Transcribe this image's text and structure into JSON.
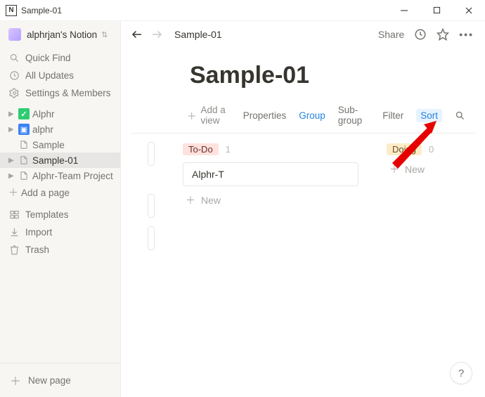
{
  "window": {
    "title": "Sample-01"
  },
  "workspace": {
    "name": "alphrjan's Notion"
  },
  "sidebar": {
    "quick_find": "Quick Find",
    "all_updates": "All Updates",
    "settings": "Settings & Members",
    "pages": [
      {
        "label": "Alphr"
      },
      {
        "label": "alphr"
      },
      {
        "label": "Sample"
      },
      {
        "label": "Sample-01"
      },
      {
        "label": "Alphr-Team Project"
      }
    ],
    "add_page": "Add a page",
    "templates": "Templates",
    "import": "Import",
    "trash": "Trash",
    "new_page": "New page"
  },
  "header": {
    "breadcrumb": "Sample-01",
    "share": "Share"
  },
  "page": {
    "title": "Sample-01"
  },
  "db_toolbar": {
    "add_view": "Add a view",
    "properties": "Properties",
    "group": "Group",
    "subgroup": "Sub-group",
    "filter": "Filter",
    "sort": "Sort"
  },
  "board": {
    "columns": [
      {
        "tag": "To-Do",
        "count": 1,
        "cards": [
          {
            "title": "Alphr-T"
          }
        ]
      },
      {
        "tag": "Doing",
        "count": 0,
        "cards": []
      }
    ],
    "new_label": "New"
  },
  "help": {
    "label": "?"
  }
}
